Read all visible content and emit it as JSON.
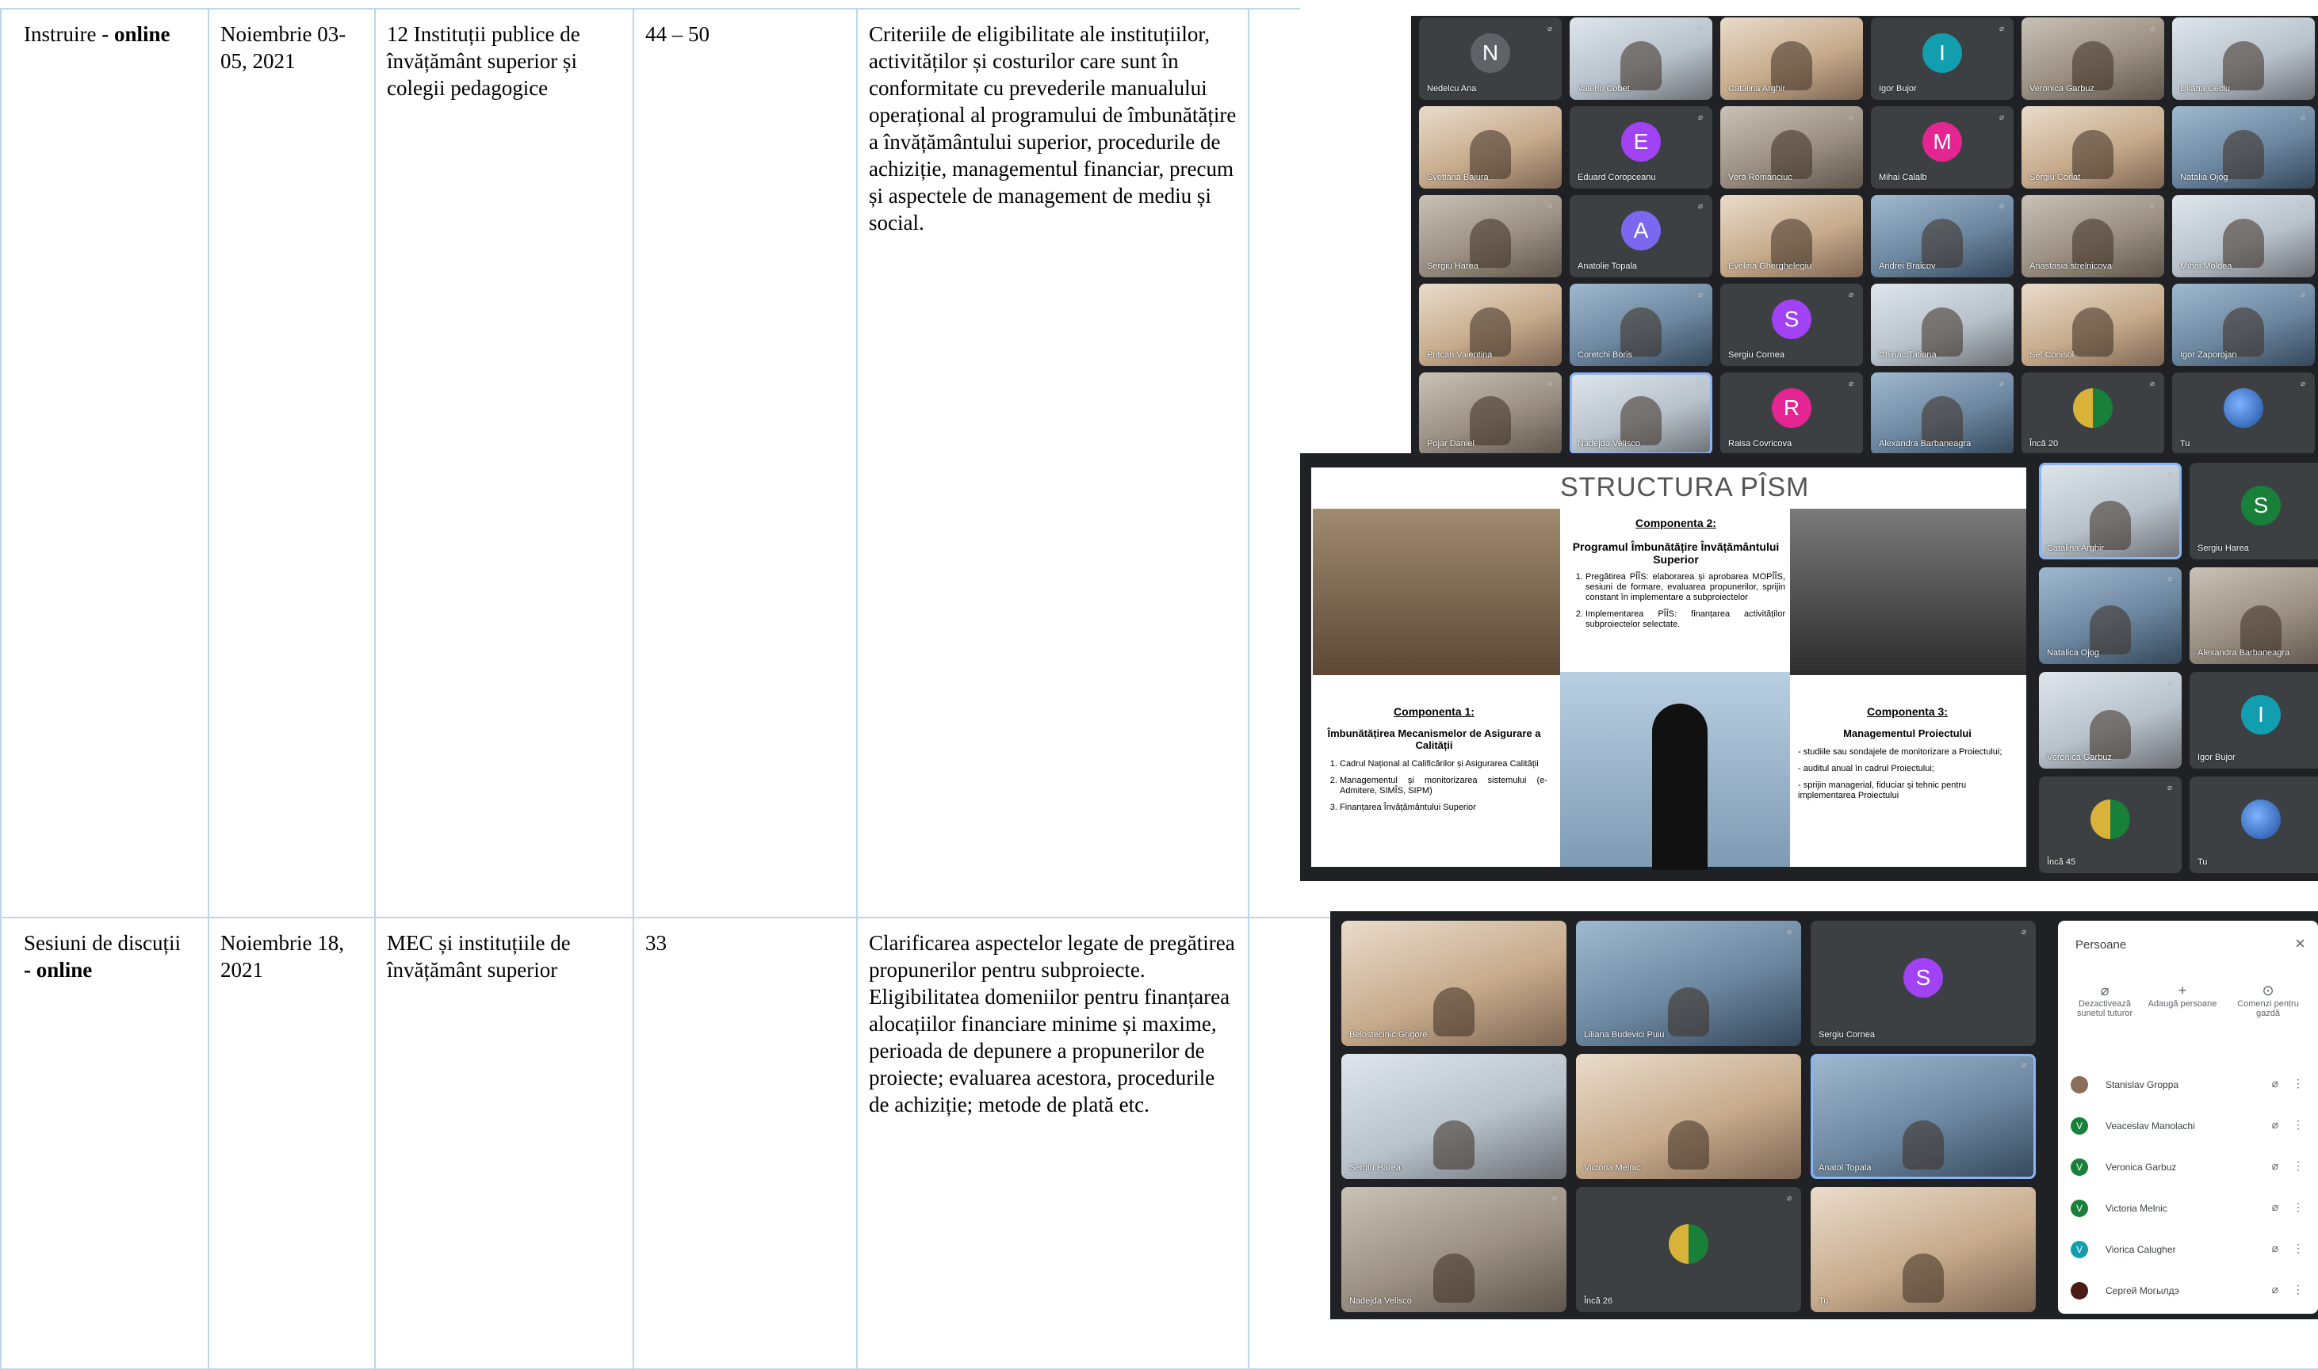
{
  "table": {
    "rows": [
      {
        "activity_prefix": "Instruire",
        "activity_bold": " - online",
        "date": "Noiembrie 03-05, 2021",
        "participants_org": "12 Instituții publice de învățământ superior și colegii pedagogice",
        "count": "44 – 50",
        "description": "Criteriile de eligibilitate ale instituțiilor, activităților și costurilor care sunt în conformitate cu prevederile manualului operațional al programului de îmbunătățire a învățământului superior, procedurile de achiziție, managementul financiar, precum și aspectele de management de mediu și social."
      },
      {
        "activity_prefix": "Sesiuni de discuții",
        "activity_bold": "- online",
        "date": "Noiembrie 18, 2021",
        "participants_org": "MEC și instituțiile de învățământ superior",
        "count": "33",
        "description_lines": [
          "Clarificarea aspectelor legate de pregătirea propunerilor pentru subproiecte.",
          "Eligibilitatea domeniilor pentru finanțarea alocațiilor financiare minime și maxime, perioada de depunere a propunerilor de proiecte; evaluarea acestora, procedurile de achiziție; metode de plată etc."
        ]
      }
    ]
  },
  "meeting1": {
    "grid": [
      {
        "name": "Nedelcu Ana",
        "initial": "N",
        "color": "#5f6368"
      },
      {
        "name": "Valeriu Cobet",
        "photo": true
      },
      {
        "name": "Catalina Arghir",
        "photo": true
      },
      {
        "name": "Igor Bujor",
        "initial": "I",
        "color": "#129eaf"
      },
      {
        "name": "Veronica Garbuz",
        "photo": true
      },
      {
        "name": "Liliana Ceclu",
        "photo": true
      },
      {
        "name": "Svetlana Bajura",
        "photo": true
      },
      {
        "name": "Eduard Coropceanu",
        "initial": "E",
        "color": "#a142f4"
      },
      {
        "name": "Vera Romanciuc",
        "photo": true
      },
      {
        "name": "Mihai Calalb",
        "initial": "M",
        "color": "#e52592"
      },
      {
        "name": "Sergiu Corlat",
        "photo": true
      },
      {
        "name": "Natalia Ojog",
        "photo": true
      },
      {
        "name": "Sergiu Harea",
        "photo": true
      },
      {
        "name": "Anatolie Topala",
        "initial": "A",
        "color": "#7b68ee"
      },
      {
        "name": "Evelina Gherghelegiu",
        "photo": true
      },
      {
        "name": "Andrei Braicov",
        "photo": true
      },
      {
        "name": "Anastasia strelnicova",
        "photo": true
      },
      {
        "name": "Mihai Moldea",
        "photo": true
      },
      {
        "name": "Pritcan Valentina",
        "photo": true
      },
      {
        "name": "Coretchi Boris",
        "photo": true
      },
      {
        "name": "Sergiu Cornea",
        "initial": "S",
        "color": "#a142f4"
      },
      {
        "name": "Chiriac Tatiana",
        "photo": true
      },
      {
        "name": "Sef Conisol",
        "photo": true
      },
      {
        "name": "Igor Zaporojan",
        "photo": true
      },
      {
        "name": "Pojar Daniel",
        "photo": true
      },
      {
        "name": "Nadejda Velisco",
        "photo": true,
        "active": true
      },
      {
        "name": "Raisa Covricova",
        "initial": "R",
        "color": "#e52592"
      },
      {
        "name": "Alexandra Barbaneagra",
        "photo": true
      },
      {
        "name": "Încă 20",
        "more": true
      },
      {
        "name": "Tu",
        "self": true
      }
    ],
    "side": [
      {
        "name": "Catalina Arghir",
        "photo": true,
        "active": true
      },
      {
        "name": "Sergiu Harea",
        "initial": "S",
        "color": "#188038"
      },
      {
        "name": "Natalica Ojog",
        "photo": true
      },
      {
        "name": "Alexandra Barbaneagra",
        "photo": true
      },
      {
        "name": "Veronica Garbuz",
        "photo": true
      },
      {
        "name": "Igor Bujor",
        "initial": "I",
        "color": "#129eaf"
      },
      {
        "name": "Încă 45",
        "more": true
      },
      {
        "name": "Tu",
        "self": true
      }
    ],
    "slide": {
      "title": "STRUCTURA PÎSM",
      "comp2_title": "Componenta 2:",
      "comp2_sub": "Programul Îmbunătățire Învățământului Superior",
      "comp2_items": [
        "Pregătirea PÎÎS: elaborarea și aprobarea MOPÎÎS, sesiuni de formare, evaluarea propunerilor, sprijin constant în implementare a subproiectelor",
        "Implementarea PÎÎS: finanțarea activităților subproiectelor selectate."
      ],
      "comp1_title": "Componenta 1:",
      "comp1_sub": "Îmbunătățirea Mecanismelor de Asigurare a Calității",
      "comp1_items": [
        "Cadrul Național al Calificărilor și Asigurarea Calității",
        "Managementul și monitorizarea sistemului (e-Admitere, SIMÎS, SIPM)",
        "Finanțarea Învățământului Superior"
      ],
      "comp3_title": "Componenta 3:",
      "comp3_sub": "Managementul Proiectului",
      "comp3_items": [
        "- studiile sau sondajele de monitorizare a Proiectului;",
        "- auditul anual în cadrul Proiectului;",
        "- sprijin managerial, fiduciar și tehnic pentru implementarea Proiectului"
      ]
    }
  },
  "meeting2": {
    "grid": [
      {
        "name": "Belostecinic Grigore",
        "photo": true
      },
      {
        "name": "Liliana Budevici Puiu",
        "photo": true
      },
      {
        "name": "Sergiu Cornea",
        "initial": "S",
        "color": "#a142f4"
      },
      {
        "name": "Sergiu Harea",
        "photo": true
      },
      {
        "name": "Victoria Melnic",
        "photo": true
      },
      {
        "name": "Anatol Topala",
        "photo": true,
        "active": true
      },
      {
        "name": "Nadejda Velisco",
        "photo": true
      },
      {
        "name": "Încă 26",
        "more": true
      },
      {
        "name": "Tu",
        "photo": true
      }
    ],
    "people_panel": {
      "title": "Persoane",
      "close_icon": "close-icon",
      "actions": [
        "Dezactivează sunetul tuturor",
        "Adaugă persoane",
        "Comenzi pentru gazdă"
      ],
      "people": [
        {
          "name": "Stanislav Groppa",
          "initial": "",
          "color": "#8a6d5a"
        },
        {
          "name": "Veaceslav Manolachi",
          "initial": "V",
          "color": "#188038"
        },
        {
          "name": "Veronica Garbuz",
          "initial": "V",
          "color": "#188038"
        },
        {
          "name": "Victoria Melnic",
          "initial": "V",
          "color": "#188038"
        },
        {
          "name": "Viorica Calugher",
          "initial": "V",
          "color": "#129eaf"
        },
        {
          "name": "Сергей Могылдэ",
          "initial": "",
          "color": "#4a1c14"
        }
      ]
    }
  }
}
